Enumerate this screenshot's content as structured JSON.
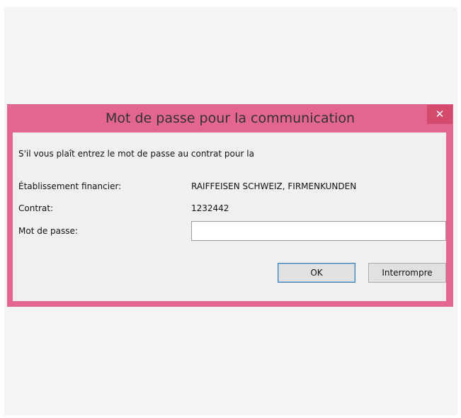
{
  "window": {
    "title": "Mot de passe pour la communication",
    "close_label": "✕"
  },
  "form": {
    "prompt": "S'il vous plaît entrez le mot de passe au contrat pour la",
    "institution_label": "Établissement financier:",
    "institution_value": "RAIFFEISEN SCHWEIZ, FIRMENKUNDEN",
    "contract_label": "Contrat:",
    "contract_value": "1232442",
    "password_label": "Mot de passe:",
    "password_value": ""
  },
  "buttons": {
    "ok_label": "OK",
    "cancel_label": "Interrompre"
  },
  "colors": {
    "titlebar": "#e36591",
    "close_button": "#d34a6d"
  }
}
